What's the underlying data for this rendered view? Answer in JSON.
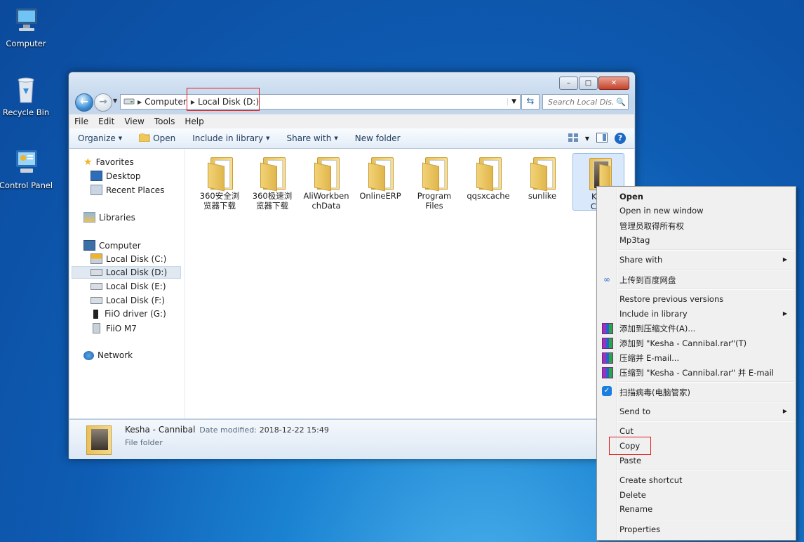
{
  "desktop": {
    "icons": [
      {
        "label": "Computer"
      },
      {
        "label": "Recycle Bin"
      },
      {
        "label": "Control Panel"
      }
    ]
  },
  "window": {
    "caption_buttons": {
      "minimize": "–",
      "maximize": "□",
      "close": "✕"
    },
    "address": {
      "segments": [
        "Computer",
        "Local Disk (D:)"
      ]
    },
    "search": {
      "placeholder": "Search Local Dis..."
    },
    "menu": [
      "File",
      "Edit",
      "View",
      "Tools",
      "Help"
    ],
    "commands": {
      "organize": "Organize",
      "open": "Open",
      "include": "Include in library",
      "share": "Share with",
      "new_folder": "New folder"
    },
    "nav": {
      "favorites": "Favorites",
      "desktop": "Desktop",
      "recent": "Recent Places",
      "libraries": "Libraries",
      "computer": "Computer",
      "drives": [
        "Local Disk (C:)",
        "Local Disk (D:)",
        "Local Disk (E:)",
        "Local Disk (F:)",
        "FiiO driver (G:)",
        "FiiO M7"
      ],
      "network": "Network"
    },
    "files": [
      {
        "line1": "360安全浏",
        "line2": "览器下载"
      },
      {
        "line1": "360极速浏",
        "line2": "览器下载"
      },
      {
        "line1": "AliWorkben",
        "line2": "chData"
      },
      {
        "line1": "OnlineERP",
        "line2": ""
      },
      {
        "line1": "Program",
        "line2": "Files"
      },
      {
        "line1": "qqsxcache",
        "line2": ""
      },
      {
        "line1": "sunlike",
        "line2": ""
      },
      {
        "line1": "Kes",
        "line2": "Can"
      }
    ],
    "details": {
      "name": "Kesha - Cannibal",
      "modified_label": "Date modified:",
      "modified_value": "2018-12-22 15:49",
      "type": "File folder"
    }
  },
  "context_menu": {
    "open": "Open",
    "open_new_window": "Open in new window",
    "admin_owner": "管理员取得所有权",
    "mp3tag": "Mp3tag",
    "share_with": "Share with",
    "baidu": "上传到百度网盘",
    "restore": "Restore previous versions",
    "include": "Include in library",
    "rar_add": "添加到压缩文件(A)...",
    "rar_add_named": "添加到 \"Kesha - Cannibal.rar\"(T)",
    "rar_email": "压缩并 E-mail...",
    "rar_named_email": "压缩到 \"Kesha - Cannibal.rar\" 并 E-mail",
    "scan": "扫描病毒(电脑管家)",
    "send_to": "Send to",
    "cut": "Cut",
    "copy": "Copy",
    "paste": "Paste",
    "create_shortcut": "Create shortcut",
    "delete": "Delete",
    "rename": "Rename",
    "properties": "Properties"
  },
  "colors": {
    "highlight_box": "#e21b1b",
    "accent": "#1c68c4"
  }
}
